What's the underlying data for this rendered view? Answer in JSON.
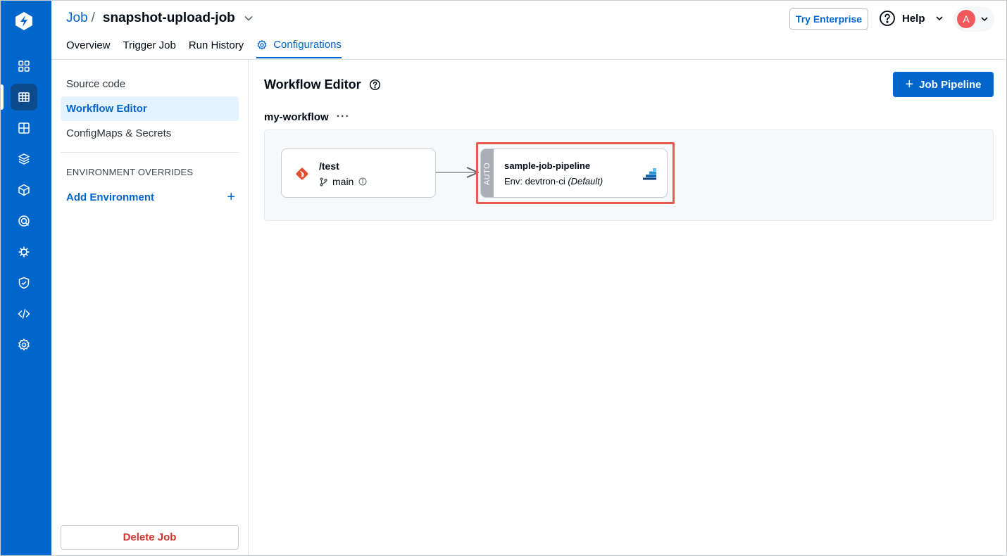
{
  "header": {
    "crumb_root": "Job",
    "crumb_sep": "/",
    "app_name": "snapshot-upload-job",
    "tabs": [
      {
        "label": "Overview"
      },
      {
        "label": "Trigger Job"
      },
      {
        "label": "Run History"
      },
      {
        "label": "Configurations"
      }
    ],
    "try_enterprise": "Try Enterprise",
    "help": "Help",
    "avatar_initial": "A"
  },
  "sidenav": {
    "items": [
      {
        "label": "Source code"
      },
      {
        "label": "Workflow Editor"
      },
      {
        "label": "ConfigMaps & Secrets"
      }
    ],
    "env_heading": "ENVIRONMENT OVERRIDES",
    "add_environment": "Add Environment",
    "add_plus": "+",
    "delete_job": "Delete Job"
  },
  "main": {
    "title": "Workflow Editor",
    "add_pipeline": "Job Pipeline",
    "add_plus": "+",
    "workflow_name": "my-workflow",
    "workflow_menu": "···",
    "source_node": {
      "title": "/test",
      "branch": "main"
    },
    "job_node": {
      "trigger": "AUTO",
      "title": "sample-job-pipeline",
      "env_prefix": "Env: devtron-ci",
      "env_suffix": "(Default)"
    }
  },
  "colors": {
    "brand": "#0066cc",
    "rail_active": "#0b4a8c",
    "highlight": "#e8594e",
    "danger": "#d0342c",
    "git": "#e44c2a"
  },
  "icons": [
    "devtron-logo-icon",
    "app-grid-icon",
    "jobs-icon",
    "chart-store-icon",
    "stack-icon",
    "cube-icon",
    "security-scan-icon",
    "bug-icon",
    "shield-icon",
    "code-icon",
    "gear-icon"
  ]
}
